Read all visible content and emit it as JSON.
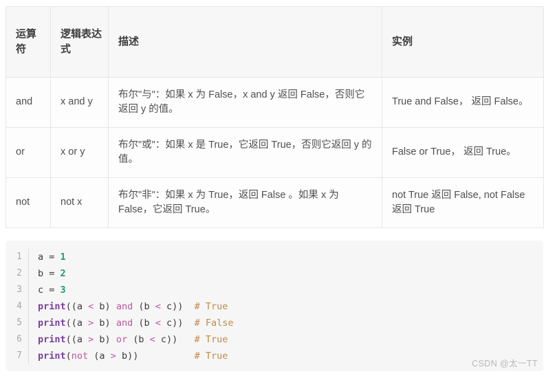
{
  "table": {
    "headers": [
      "运算符",
      "逻辑表达式",
      "描述",
      "实例"
    ],
    "rows": [
      {
        "operator": "and",
        "expression": "x and y",
        "description": "布尔\"与\"：如果 x 为 False，x and y 返回 False，否则它返回 y 的值。",
        "example": "True and False， 返回 False。"
      },
      {
        "operator": "or",
        "expression": "x or y",
        "description": "布尔\"或\"：如果 x 是 True，它返回 True，否则它返回 y 的值。",
        "example": "False or True， 返回 True。"
      },
      {
        "operator": "not",
        "expression": "not x",
        "description": "布尔\"非\"：如果 x 为 True，返回 False 。如果 x 为 False，它返回 True。",
        "example": "not True 返回 False, not False 返回 True"
      }
    ]
  },
  "code": {
    "language": "python",
    "line_numbers": [
      "1",
      "2",
      "3",
      "4",
      "5",
      "6",
      "7"
    ],
    "lines": [
      {
        "number": "1",
        "plain": "a = 1",
        "tokens": [
          {
            "t": "a",
            "c": "tok-name"
          },
          {
            "t": " = ",
            "c": "tok-eq"
          },
          {
            "t": "1",
            "c": "tok-num"
          }
        ]
      },
      {
        "number": "2",
        "plain": "b = 2",
        "tokens": [
          {
            "t": "b",
            "c": "tok-name"
          },
          {
            "t": " = ",
            "c": "tok-eq"
          },
          {
            "t": "2",
            "c": "tok-num"
          }
        ]
      },
      {
        "number": "3",
        "plain": "c = 3",
        "tokens": [
          {
            "t": "c",
            "c": "tok-name"
          },
          {
            "t": " = ",
            "c": "tok-eq"
          },
          {
            "t": "3",
            "c": "tok-num"
          }
        ]
      },
      {
        "number": "4",
        "plain": "print((a < b) and (b < c))  # True",
        "tokens": [
          {
            "t": "print",
            "c": "tok-fn"
          },
          {
            "t": "((a ",
            "c": "tok-punct"
          },
          {
            "t": "<",
            "c": "tok-op"
          },
          {
            "t": " b) ",
            "c": "tok-punct"
          },
          {
            "t": "and",
            "c": "tok-kw"
          },
          {
            "t": " (b ",
            "c": "tok-punct"
          },
          {
            "t": "<",
            "c": "tok-op"
          },
          {
            "t": " c))  ",
            "c": "tok-punct"
          },
          {
            "t": "# True",
            "c": "tok-comment"
          }
        ]
      },
      {
        "number": "5",
        "plain": "print((a > b) and (b < c))  # False",
        "tokens": [
          {
            "t": "print",
            "c": "tok-fn"
          },
          {
            "t": "((a ",
            "c": "tok-punct"
          },
          {
            "t": ">",
            "c": "tok-op"
          },
          {
            "t": " b) ",
            "c": "tok-punct"
          },
          {
            "t": "and",
            "c": "tok-kw"
          },
          {
            "t": " (b ",
            "c": "tok-punct"
          },
          {
            "t": "<",
            "c": "tok-op"
          },
          {
            "t": " c))  ",
            "c": "tok-punct"
          },
          {
            "t": "# False",
            "c": "tok-comment"
          }
        ]
      },
      {
        "number": "6",
        "plain": "print((a > b) or (b < c))   # True",
        "tokens": [
          {
            "t": "print",
            "c": "tok-fn"
          },
          {
            "t": "((a ",
            "c": "tok-punct"
          },
          {
            "t": ">",
            "c": "tok-op"
          },
          {
            "t": " b) ",
            "c": "tok-punct"
          },
          {
            "t": "or",
            "c": "tok-kw"
          },
          {
            "t": " (b ",
            "c": "tok-punct"
          },
          {
            "t": "<",
            "c": "tok-op"
          },
          {
            "t": " c))   ",
            "c": "tok-punct"
          },
          {
            "t": "# True",
            "c": "tok-comment"
          }
        ]
      },
      {
        "number": "7",
        "plain": "print(not (a > b))          # True",
        "tokens": [
          {
            "t": "print",
            "c": "tok-fn"
          },
          {
            "t": "(",
            "c": "tok-punct"
          },
          {
            "t": "not",
            "c": "tok-kw"
          },
          {
            "t": " (a ",
            "c": "tok-punct"
          },
          {
            "t": ">",
            "c": "tok-op"
          },
          {
            "t": " b))          ",
            "c": "tok-punct"
          },
          {
            "t": "# True",
            "c": "tok-comment"
          }
        ]
      }
    ]
  },
  "watermark": {
    "text": "CSDN @太一TT"
  },
  "colors": {
    "header_bg": "#f7f7f7",
    "cell_bg": "#fdfdfd",
    "border": "#e6e6e6",
    "code_bg": "#f6f6f6",
    "keyword": "#c0559f",
    "function": "#7b3fa0",
    "number": "#23967f",
    "comment": "#bf8b4a",
    "line_number": "#a8a8a8",
    "watermark": "#b9b9b9"
  }
}
